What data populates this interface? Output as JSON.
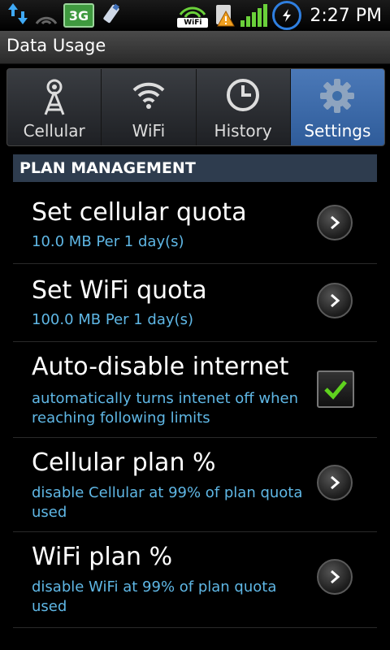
{
  "status_bar": {
    "time": "2:27 PM",
    "network_badge": "3G",
    "wifi_label": "WiFi",
    "icons": [
      "download-arrows-icon",
      "empty-signal-icon",
      "3g-icon",
      "usb-icon",
      "wifi-icon",
      "sim-warning-icon",
      "cell-signal-icon",
      "sync-icon"
    ]
  },
  "header": {
    "title": "Data Usage"
  },
  "tabs": [
    {
      "label": "Cellular",
      "icon": "antenna-icon",
      "active": false
    },
    {
      "label": "WiFi",
      "icon": "wifi-icon",
      "active": false
    },
    {
      "label": "History",
      "icon": "clock-icon",
      "active": false
    },
    {
      "label": "Settings",
      "icon": "gear-icon",
      "active": true
    }
  ],
  "section": {
    "title": "PLAN MANAGEMENT"
  },
  "items": [
    {
      "title": "Set cellular quota",
      "summary": "10.0 MB Per 1 day(s)",
      "control": "chevron"
    },
    {
      "title": "Set WiFi quota",
      "summary": "100.0 MB Per 1 day(s)",
      "control": "chevron"
    },
    {
      "title": "Auto-disable internet",
      "summary": "automatically turns intenet off when reaching following limits",
      "control": "checkbox",
      "checked": true
    },
    {
      "title": "Cellular plan %",
      "summary": "disable Cellular at 99% of plan quota used",
      "control": "chevron"
    },
    {
      "title": "WiFi plan %",
      "summary": "disable WiFi at 99% of plan quota used",
      "control": "chevron"
    }
  ],
  "colors": {
    "accent": "#5fb7e5",
    "tab_active": "#3e6ea8",
    "check_green": "#5fd21e"
  }
}
